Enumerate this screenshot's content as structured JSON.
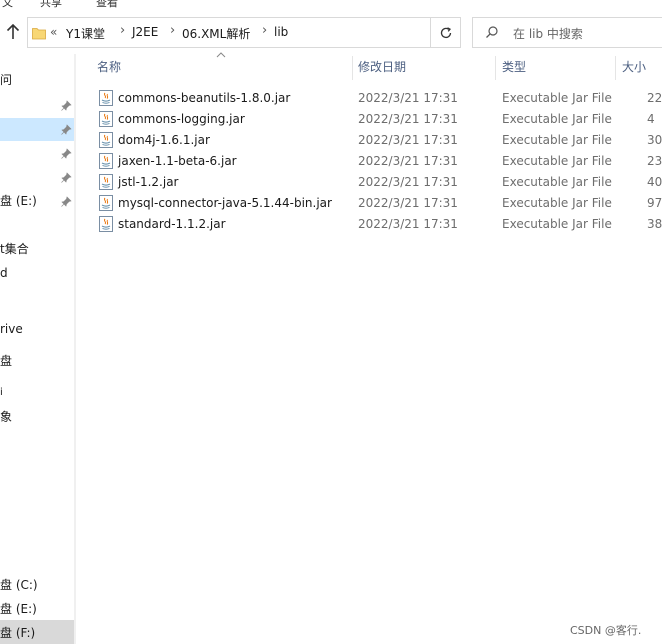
{
  "toolbar_fragments": [
    "文",
    "共享",
    "查看"
  ],
  "address": {
    "overflow_chevron": "«",
    "crumbs": [
      "Y1课堂",
      "J2EE",
      "06.XML解析",
      "lib"
    ],
    "separator": "›"
  },
  "search": {
    "placeholder": "在 lib 中搜索"
  },
  "sidebar": {
    "items": [
      "问",
      "盘 (E:)",
      "t集合",
      "d",
      "rive",
      "盘",
      "象",
      "盘 (C:)",
      "盘 (E:)",
      "盘 (F:)"
    ]
  },
  "columns": {
    "name": "名称",
    "date": "修改日期",
    "type": "类型",
    "size": "大小"
  },
  "files": [
    {
      "name": "commons-beanutils-1.8.0.jar",
      "date": "2022/3/21 17:31",
      "type": "Executable Jar File",
      "size": "22"
    },
    {
      "name": "commons-logging.jar",
      "date": "2022/3/21 17:31",
      "type": "Executable Jar File",
      "size": "4"
    },
    {
      "name": "dom4j-1.6.1.jar",
      "date": "2022/3/21 17:31",
      "type": "Executable Jar File",
      "size": "30"
    },
    {
      "name": "jaxen-1.1-beta-6.jar",
      "date": "2022/3/21 17:31",
      "type": "Executable Jar File",
      "size": "23"
    },
    {
      "name": "jstl-1.2.jar",
      "date": "2022/3/21 17:31",
      "type": "Executable Jar File",
      "size": "40"
    },
    {
      "name": "mysql-connector-java-5.1.44-bin.jar",
      "date": "2022/3/21 17:31",
      "type": "Executable Jar File",
      "size": "97"
    },
    {
      "name": "standard-1.1.2.jar",
      "date": "2022/3/21 17:31",
      "type": "Executable Jar File",
      "size": "38"
    }
  ],
  "watermark": "CSDN @客行.",
  "colors": {
    "selected_nav": "#cce8ff",
    "active_drive": "#d9d9d9",
    "header_text": "#4d6082",
    "folder_yellow": "#f8d775"
  }
}
